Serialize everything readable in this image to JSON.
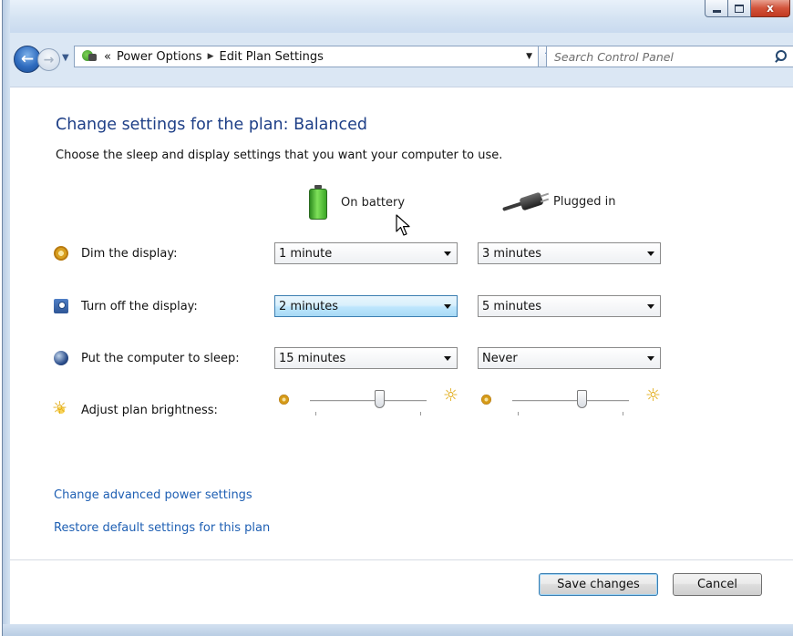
{
  "window": {
    "caption_buttons": [
      "minimize",
      "maximize",
      "close"
    ],
    "close_glyph": "x"
  },
  "nav": {
    "breadcrumb_overflow": "«",
    "breadcrumb": [
      "Power Options",
      "Edit Plan Settings"
    ],
    "search_placeholder": "Search Control Panel"
  },
  "page": {
    "title": "Change settings for the plan: Balanced",
    "description": "Choose the sleep and display settings that you want your computer to use."
  },
  "columns": {
    "battery": "On battery",
    "plugged": "Plugged in"
  },
  "settings": [
    {
      "label": "Dim the display:",
      "battery": "1 minute",
      "plugged": "3 minutes",
      "icon": "dim-display-icon"
    },
    {
      "label": "Turn off the display:",
      "battery": "2 minutes",
      "plugged": "5 minutes",
      "icon": "monitor-off-icon"
    },
    {
      "label": "Put the computer to sleep:",
      "battery": "15 minutes",
      "plugged": "Never",
      "icon": "sleep-icon"
    }
  ],
  "brightness": {
    "label": "Adjust plan brightness:",
    "battery_level_fraction": 0.6,
    "plugged_level_fraction": 0.6
  },
  "links": {
    "advanced": "Change advanced power settings",
    "restore": "Restore default settings for this plan"
  },
  "buttons": {
    "save": "Save changes",
    "cancel": "Cancel"
  },
  "colors": {
    "title_blue": "#1e3f87",
    "link_blue": "#1e5fb3",
    "hover_blue": "#bee6fd"
  }
}
